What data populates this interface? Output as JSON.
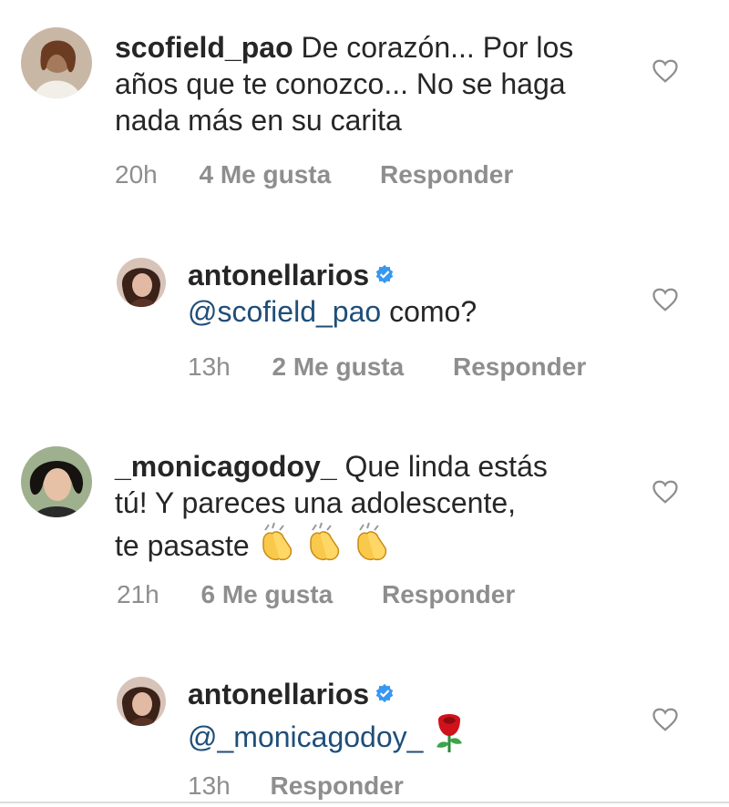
{
  "comments": [
    {
      "username": "scofield_pao",
      "verified": false,
      "text": "De corazón... Por los años que te conozco... No se haga nada más en su carita",
      "time": "20h",
      "likes": "4 Me gusta",
      "reply": "Responder"
    },
    {
      "username": "antonellarios",
      "verified": true,
      "mention": "@scofield_pao",
      "text": "como?",
      "time": "13h",
      "likes": "2 Me gusta",
      "reply": "Responder"
    },
    {
      "username": "_monicagodoy_",
      "verified": false,
      "text_line1": "Que linda estás",
      "text_line2": "tú! Y pareces una adolescente,",
      "text_line3": "te pasaste",
      "emoji": "clapping-hands",
      "time": "21h",
      "likes": "6 Me gusta",
      "reply": "Responder"
    },
    {
      "username": "antonellarios",
      "verified": true,
      "mention": "@_monicagodoy_",
      "emoji": "rose",
      "time": "13h",
      "reply": "Responder"
    }
  ],
  "colors": {
    "text": "#262626",
    "meta": "#8e8e8e",
    "mention": "#1f4e79",
    "verified": "#3897f0"
  },
  "icons": {
    "like": "heart-outline-icon",
    "verified": "verified-badge-icon"
  }
}
